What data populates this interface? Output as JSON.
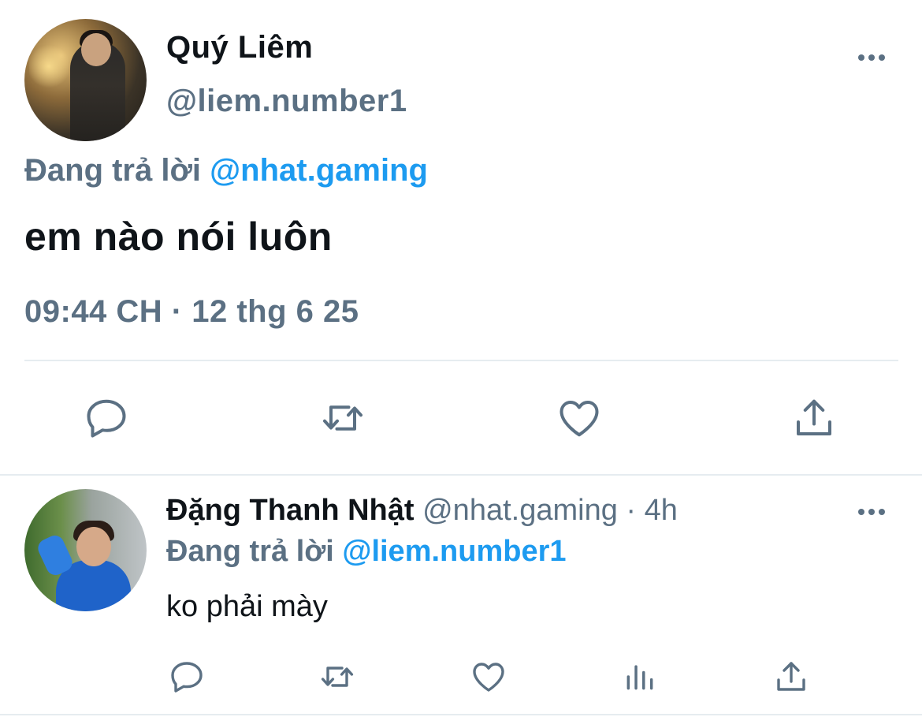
{
  "main_tweet": {
    "author_name": "Quý Liêm",
    "author_handle": "@liem.number1",
    "replying_prefix": "Đang trả lời",
    "replying_to": "@nhat.gaming",
    "text": "em nào nói luôn",
    "timestamp": "09:44 CH · 12 thg 6 25",
    "more_icon": "more-horizontal-icon",
    "actions": [
      "reply-icon",
      "retweet-icon",
      "like-icon",
      "share-icon"
    ]
  },
  "reply_tweet": {
    "author_name": "Đặng Thanh Nhật",
    "author_handle": "@nhat.gaming",
    "separator": " · ",
    "time_ago": "4h",
    "replying_prefix": "Đang trả lời",
    "replying_to": "@liem.number1",
    "text": "ko phải mày",
    "more_icon": "more-horizontal-icon",
    "actions": [
      "reply-icon",
      "retweet-icon",
      "like-icon",
      "analytics-icon",
      "share-icon"
    ]
  },
  "colors": {
    "text_primary": "#0f1419",
    "text_secondary": "#5b7083",
    "accent": "#1d9bf0",
    "divider": "#e6ecf0"
  }
}
